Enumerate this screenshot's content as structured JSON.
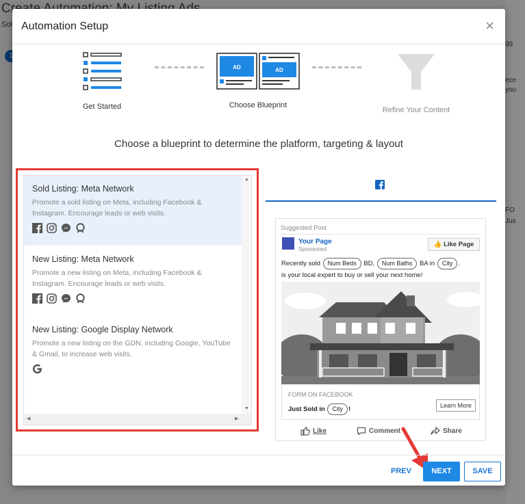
{
  "background": {
    "title": "Create Automation: My Listing Ads",
    "subtitle": "Sol",
    "step_badge": "1",
    "right_fragments": [
      "gg",
      "ece",
      "you",
      "FO",
      "Jus"
    ]
  },
  "modal": {
    "title": "Automation Setup",
    "close_label": "×"
  },
  "stepper": [
    {
      "label": "Get Started",
      "state": "done"
    },
    {
      "label": "Choose Blueprint",
      "state": "active",
      "ad_label": "AD"
    },
    {
      "label": "Refine Your Content",
      "state": "upcoming"
    }
  ],
  "prompt": "Choose a blueprint to determine the platform, targeting & layout",
  "blueprints": [
    {
      "title": "Sold Listing: Meta Network",
      "desc": "Promote a sold listing on Meta, including Facebook & Instagram. Encourage leads or web visits.",
      "icons": [
        "facebook-icon",
        "instagram-icon",
        "messenger-icon",
        "audience-network-icon"
      ],
      "selected": true
    },
    {
      "title": "New Listing: Meta Network",
      "desc": "Promote a new listing on Meta, including Facebook & Instagram. Encourage leads or web visits.",
      "icons": [
        "facebook-icon",
        "instagram-icon",
        "messenger-icon",
        "audience-network-icon"
      ],
      "selected": false
    },
    {
      "title": "New Listing: Google Display Network",
      "desc": "Promote a new listing on the GDN, including Google, YouTube & Gmail, to increase web visits.",
      "icons": [
        "google-icon"
      ],
      "selected": false
    }
  ],
  "preview": {
    "platform_tab": "facebook-icon",
    "suggested": "Suggested Post",
    "page_name": "Your Page",
    "sponsored": "Sponsored",
    "like_page": "Like Page",
    "text_1": "Recently sold",
    "chip_beds": "Num Beds",
    "text_bd": "BD,",
    "chip_baths": "Num Baths",
    "text_ba": "BA in",
    "chip_city": "City",
    "text_end": ".",
    "text_2": "is your local expert to buy or sell your next home!",
    "form_label": "FORM ON FACEBOOK",
    "just_sold": "Just Sold in",
    "chip_city_2": "City",
    "just_sold_end": "!",
    "learn_more": "Learn More",
    "like": "Like",
    "comment": "Comment",
    "share": "Share"
  },
  "footer": {
    "prev": "PREV",
    "next": "NEXT",
    "save": "SAVE"
  },
  "colors": {
    "accent": "#1e88e5",
    "highlight_border": "#e53935",
    "selected_bg": "#e8f0fb"
  }
}
